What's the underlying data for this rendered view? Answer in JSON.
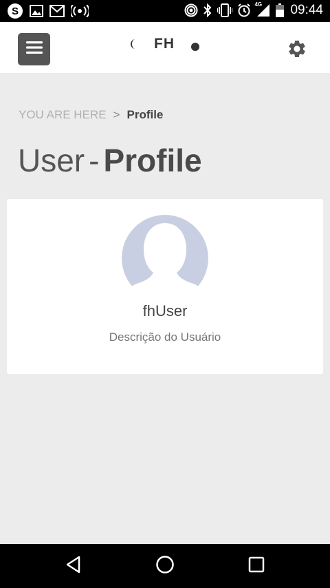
{
  "status_bar": {
    "time": "09:44",
    "network_label": "4G",
    "left_icons": [
      "skype-icon",
      "image-icon",
      "gmail-icon",
      "broadcast-icon"
    ],
    "right_icons": [
      "hotspot-icon",
      "bluetooth-icon",
      "vibrate-icon",
      "alarm-icon",
      "signal-icon",
      "battery-icon"
    ]
  },
  "header": {
    "brand_text": "FH",
    "menu_icon": "hamburger-icon",
    "settings_icon": "gear-icon"
  },
  "breadcrumb": {
    "prefix": "YOU ARE HERE",
    "separator": ">",
    "current": "Profile"
  },
  "page_title": {
    "light": "User",
    "separator": "-",
    "bold": "Profile"
  },
  "profile": {
    "username": "fhUser",
    "description": "Descrição do Usuário"
  },
  "nav_bar": {
    "buttons": [
      "back-icon",
      "home-icon",
      "recents-icon"
    ]
  },
  "colors": {
    "header_bg": "#ffffff",
    "page_bg": "#ececec",
    "menu_button_bg": "#555555",
    "avatar_bg": "#c9cfe2",
    "avatar_silhouette": "#ffffff"
  }
}
